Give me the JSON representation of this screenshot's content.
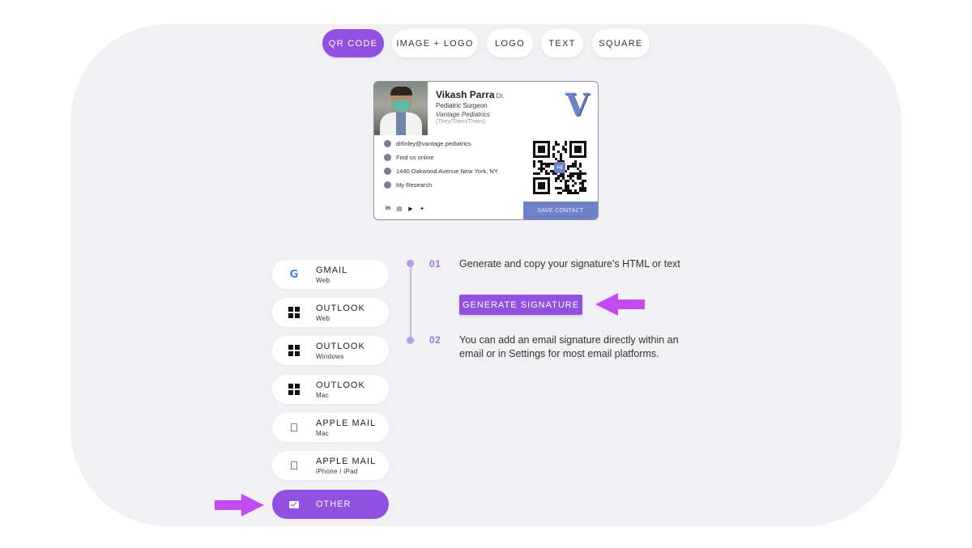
{
  "tabs": [
    {
      "label": "QR CODE",
      "active": true
    },
    {
      "label": "IMAGE + LOGO",
      "active": false
    },
    {
      "label": "LOGO",
      "active": false
    },
    {
      "label": "TEXT",
      "active": false
    },
    {
      "label": "SQUARE",
      "active": false
    }
  ],
  "signature": {
    "name": "Vikash Parra",
    "name_suffix": "Dr.",
    "title": "Pediatric Surgeon",
    "company": "Vantage Pediatrics",
    "pronouns": "(They/Them/Theirs)",
    "logo_letter": "V",
    "contacts": [
      {
        "icon": "email-icon",
        "text": "drfinley@vantage.pediatrics"
      },
      {
        "icon": "link-icon",
        "text": "Find us online"
      },
      {
        "icon": "location-icon",
        "text": "1440 Oakwood Avenue New York, NY"
      },
      {
        "icon": "calendar-icon",
        "text": "My Research"
      }
    ],
    "qr_badge": "Hi",
    "social_icons": [
      "linkedin-icon",
      "print-icon",
      "youtube-icon",
      "twitter-icon"
    ],
    "social_glyphs": [
      "in",
      "▤",
      "▶",
      "✦"
    ],
    "save_contact_label": "SAVE CONTACT"
  },
  "clients": [
    {
      "name": "GMAIL",
      "sub": "Web",
      "icon": "google-icon",
      "active": false
    },
    {
      "name": "OUTLOOK",
      "sub": "Web",
      "icon": "windows-icon",
      "active": false
    },
    {
      "name": "OUTLOOK",
      "sub": "Windows",
      "icon": "windows-icon",
      "active": false
    },
    {
      "name": "OUTLOOK",
      "sub": "Mac",
      "icon": "windows-icon",
      "active": false
    },
    {
      "name": "APPLE MAIL",
      "sub": "Mac",
      "icon": "apple-icon",
      "active": false
    },
    {
      "name": "APPLE MAIL",
      "sub": "iPhone / iPad",
      "icon": "apple-icon",
      "active": false
    },
    {
      "name": "OTHER",
      "sub": "",
      "icon": "mail-icon",
      "active": true
    }
  ],
  "steps": [
    {
      "num": "01",
      "text": "Generate and copy your signature's HTML or text"
    },
    {
      "num": "02",
      "text": "You can add an email signature directly within an email or in Settings for most email platforms."
    }
  ],
  "generate_button_label": "GENERATE SIGNATURE",
  "colors": {
    "accent": "#9150e0",
    "arrow": "#c24cf0",
    "card_accent": "#6f82c8",
    "panel": "#f1f0f2"
  }
}
